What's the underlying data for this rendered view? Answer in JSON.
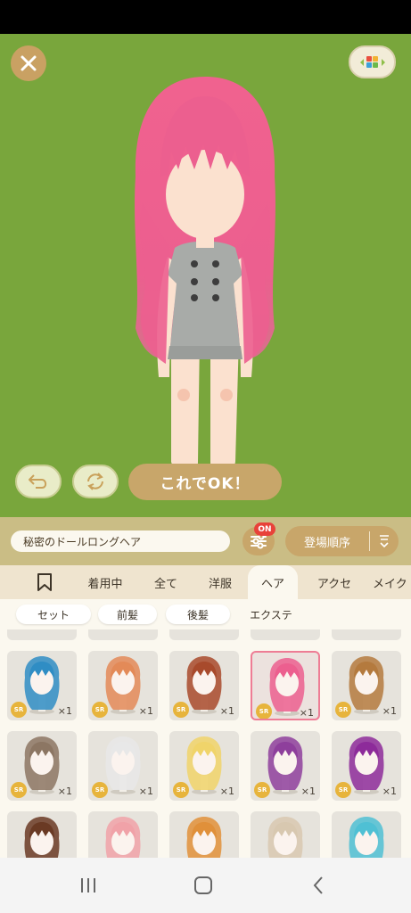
{
  "stage": {
    "ok_label": "これでOK！"
  },
  "item_bar": {
    "item_name": "秘密のドールロングヘア",
    "filter_badge": "ON",
    "sort_label": "登場順序"
  },
  "tabs": [
    {
      "label": "着用中"
    },
    {
      "label": "全て"
    },
    {
      "label": "洋服"
    },
    {
      "label": "ヘア",
      "active": true
    },
    {
      "label": "アクセ"
    },
    {
      "label": "メイク"
    }
  ],
  "subtabs": [
    {
      "label": "セット",
      "active": true
    },
    {
      "label": "前髪",
      "active": true
    },
    {
      "label": "後髪",
      "active": true
    },
    {
      "label": "エクステ"
    }
  ],
  "grid": {
    "rarity": "SR",
    "quantity": "×1",
    "rows": [
      [
        {
          "hair_color": "#2f8dc4"
        },
        {
          "hair_color": "#e38a58"
        },
        {
          "hair_color": "#a84a2c"
        },
        {
          "hair_color": "#ec5f8f",
          "selected": true
        },
        {
          "hair_color": "#b47a3e"
        }
      ],
      [
        {
          "hair_color": "#8c7663"
        },
        {
          "hair_color": "#e8e8e8"
        },
        {
          "hair_color": "#f0d46a"
        },
        {
          "hair_color": "#8e3f9c"
        },
        {
          "hair_color": "#8d2b9a"
        }
      ],
      [
        {
          "hair_color": "#6a3a24"
        },
        {
          "hair_color": "#f0a2a8"
        },
        {
          "hair_color": "#e0903a"
        },
        {
          "hair_color": "#d8c8b0"
        },
        {
          "hair_color": "#4fc0d4"
        }
      ]
    ]
  },
  "colors": {
    "stage_bg": "#79a63c",
    "gold_button": "#c8a66a",
    "badge_red": "#e8423a",
    "selected_border": "#ee7d95"
  }
}
